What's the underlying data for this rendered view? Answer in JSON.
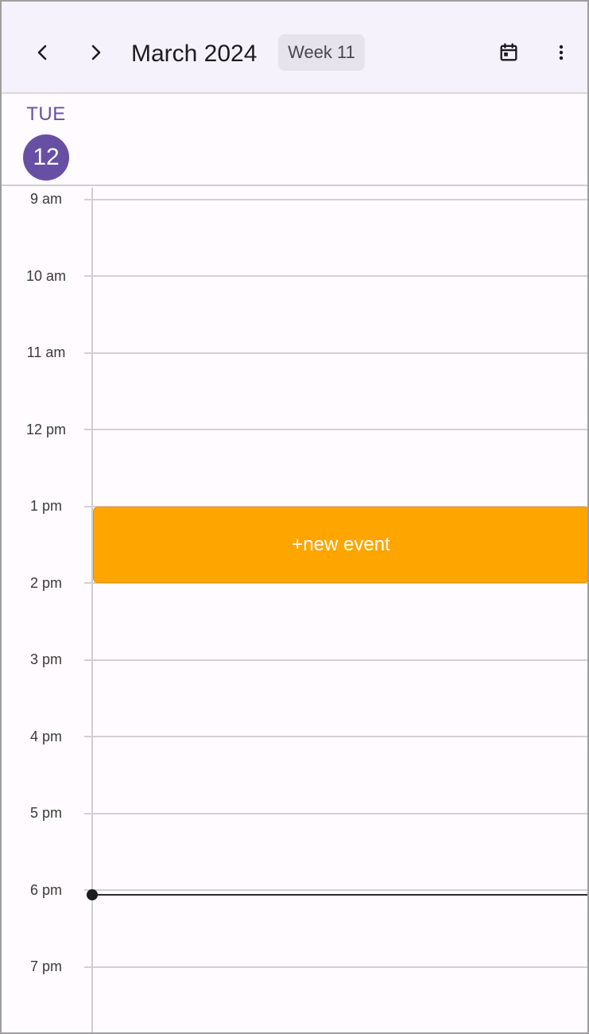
{
  "header": {
    "prev_icon": "chevron-left-icon",
    "next_icon": "chevron-right-icon",
    "title": "March 2024",
    "week_chip": "Week 11",
    "calendar_icon": "calendar-today-icon",
    "more_icon": "more-vertical-icon"
  },
  "day": {
    "weekday": "TUE",
    "date": "12"
  },
  "timeline": {
    "hours": [
      "9 am",
      "10 am",
      "11 am",
      "12 pm",
      "1 pm",
      "2 pm",
      "3 pm",
      "4 pm",
      "5 pm",
      "6 pm",
      "7 pm"
    ]
  },
  "event": {
    "label": "+new event",
    "color": "#ffa500"
  },
  "colors": {
    "accent": "#6750a4",
    "topbar_bg": "#f5f2fb",
    "background": "#fffbfe"
  }
}
